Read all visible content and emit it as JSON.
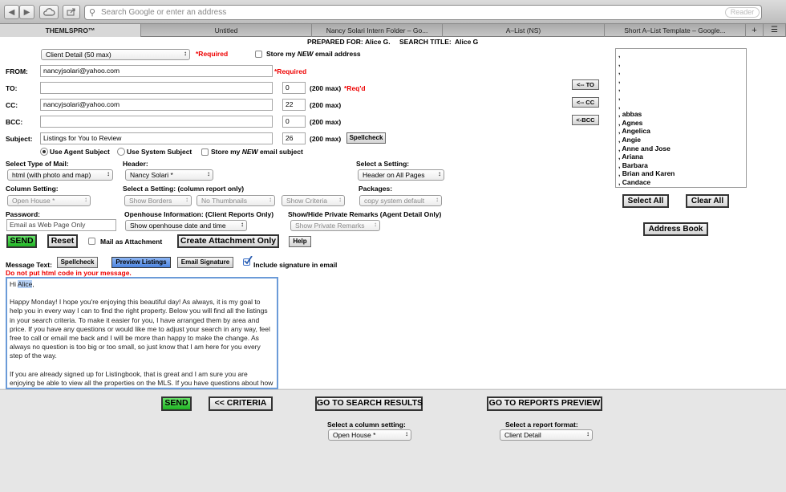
{
  "browser": {
    "address_placeholder": "Search Google or enter an address",
    "reader_label": "Reader",
    "back_icon": "back-arrow-icon",
    "tabs": [
      "THEMLSPRO™",
      "Untitled",
      "Nancy Solari Intern Folder – Go...",
      "A–List (NS)",
      "Short A–List Template – Google..."
    ]
  },
  "header": {
    "prepared_for_label": "PREPARED FOR:",
    "prepared_for_value": "Alice G.",
    "search_title_label": "SEARCH TITLE:",
    "search_title_value": "Alice G"
  },
  "form": {
    "report_select": "Client Detail (50 max)",
    "required": "*Required",
    "store_email_prefix": "Store my ",
    "store_email_new": "NEW",
    "store_email_suffix": " email address",
    "from_label": "FROM:",
    "from_value": "nancyjsolari@yahoo.com",
    "to_label": "TO:",
    "to_value": "",
    "to_count": "0",
    "to_max": "(200 max)",
    "req_d": "*Req'd",
    "cc_label": "CC:",
    "cc_value": "nancyjsolari@yahoo.com",
    "cc_count": "22",
    "cc_max": "(200 max)",
    "bcc_label": "BCC:",
    "bcc_value": "",
    "bcc_count": "0",
    "bcc_max": "(200 max)",
    "subject_label": "Subject:",
    "subject_value": "Listings for You to Review",
    "subject_count": "26",
    "subject_max": "(200 max)",
    "spellcheck": "Spellcheck",
    "use_agent_subject": "Use Agent Subject",
    "use_system_subject": "Use System Subject",
    "store_subject_prefix": "Store my ",
    "store_subject_new": "NEW",
    "store_subject_suffix": " email subject",
    "type_mail_label": "Select Type of Mail:",
    "type_mail_value": "html (with photo and map)",
    "header_label": "Header:",
    "header_value": "Nancy Solari *",
    "setting_label": "Select a Setting:",
    "setting_value": "Header on All Pages",
    "column_setting_label": "Column Setting:",
    "column_setting_value": "Open House *",
    "select_setting_col_label": "Select a Setting:  (column report only)",
    "show_borders": "Show Borders",
    "no_thumbnails": "No Thumbnails",
    "show_criteria": "Show Criteria",
    "packages_label": "Packages:",
    "packages_value": "copy system default",
    "password_label": "Password:",
    "password_value": "Email as Web Page Only",
    "openhouse_label": "Openhouse Information: (Client Reports Only)",
    "openhouse_value": "Show openhouse date and time",
    "private_label": "Show/Hide Private Remarks (Agent Detail Only)",
    "private_value": "Show Private Remarks",
    "send": "SEND",
    "reset": "Reset",
    "mail_attachment": "Mail as Attachment",
    "create_attachment": "Create Attachment Only",
    "help": "Help",
    "message_text_label": "Message Text:",
    "msg_spellcheck": "Spellcheck",
    "preview_listings": "Preview Listings",
    "email_signature": "Email Signature",
    "include_signature": "Include signature in email",
    "no_html_warning": "Do not put html code in your message.",
    "msg_greeting_prefix": "Hi ",
    "msg_greeting_name": "Alice",
    "msg_greeting_suffix": ",",
    "msg_p1": "Happy Monday!  I hope you're enjoying this beautiful day! As always, it is my goal to help you in every way I can to find the right property.  Below you will find all the listings in your search criteria.  To make it easier for you, I have arranged them by area and price.  If you have any questions or would like me to adjust your search in any way, feel free to call or email me back and I will be more than happy to make the change.  As always no question is too big or too small, so just know that I am here for you every step of the way.",
    "msg_p2": "If you are already signed up for Listingbook, that is great and I am sure you are enjoying be able to view all the properties on the MLS.  If you have questions about how Listingbook works or are not signed up, it is a free service where you will have complete access to go onto the MLS (Multiple Listing Service - where all"
  },
  "recipients": {
    "to_btn": "<-- TO",
    "cc_btn": "<-- CC",
    "bcc_btn": "<-BCC",
    "list": [
      ",",
      ",",
      ",",
      ",",
      ",",
      ",",
      ",",
      ", abbas",
      ", Agnes",
      ", Angelica",
      ", Angie",
      ", Anne and Jose",
      ", Ariana",
      ", Barbara",
      ", Brian and Karen",
      ", Candace"
    ],
    "select_all": "Select All",
    "clear_all": "Clear All",
    "address_book": "Address Book"
  },
  "footer": {
    "send": "SEND",
    "criteria": "<< CRITERIA",
    "search_results": "GO TO SEARCH RESULTS",
    "reports_preview": "GO TO REPORTS PREVIEW",
    "column_label": "Select a column setting:",
    "column_value": "Open House *",
    "format_label": "Select a report format:",
    "format_value": "Client Detail"
  }
}
